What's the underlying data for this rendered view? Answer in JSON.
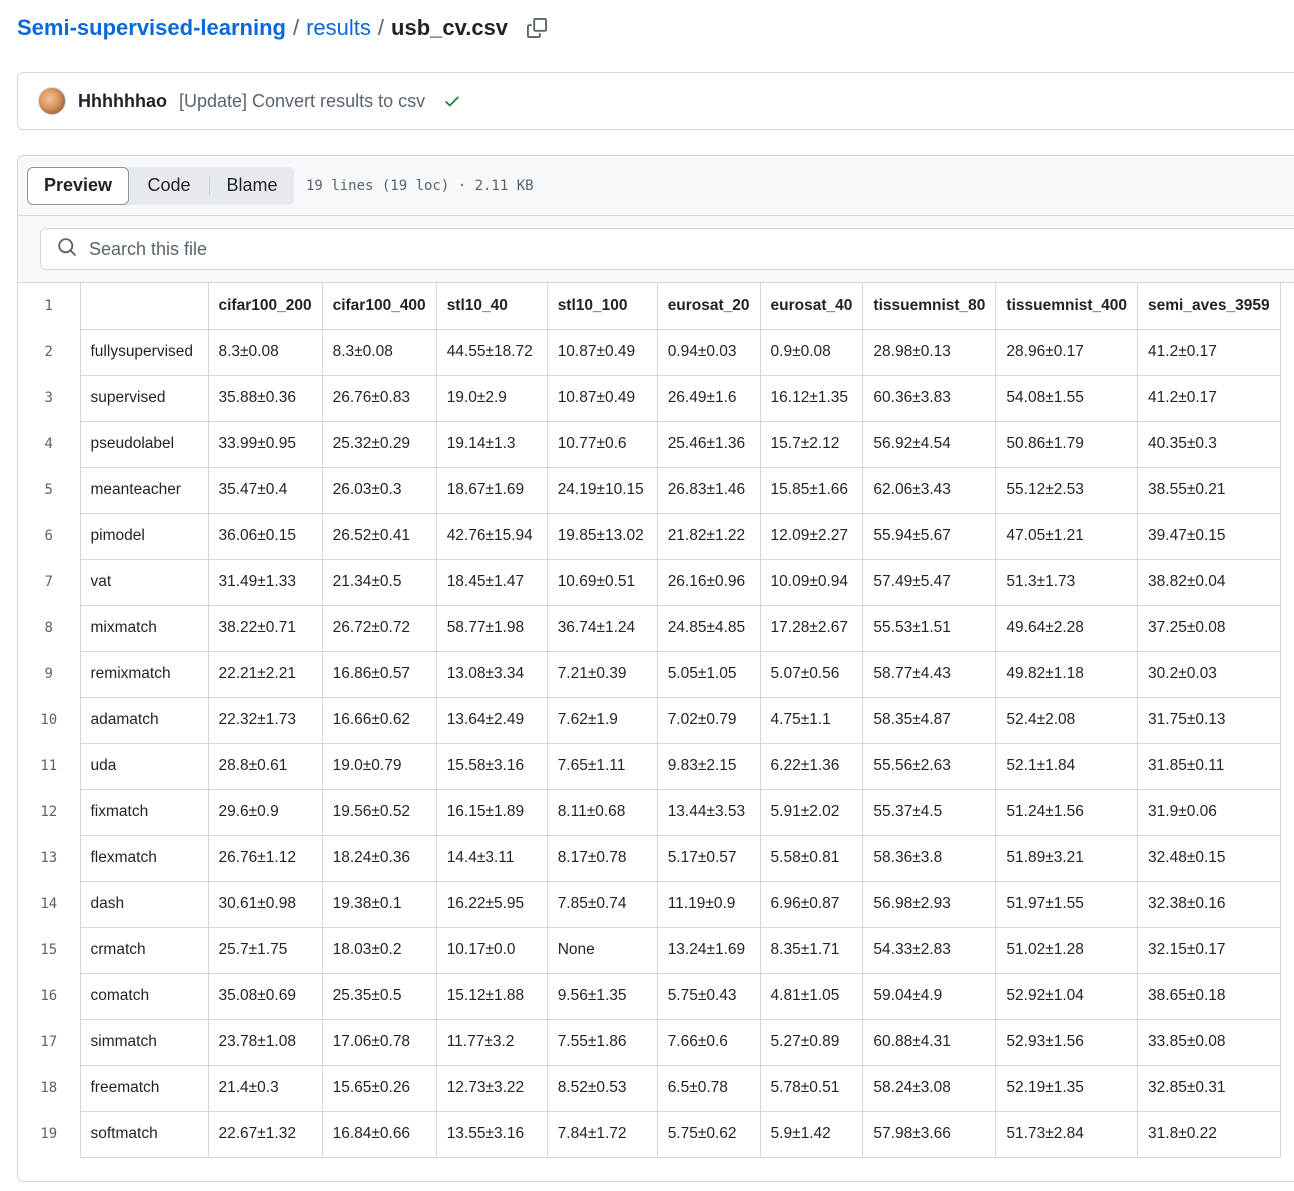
{
  "breadcrumb": {
    "repo": "Semi-supervised-learning",
    "sep1": "/",
    "folder": "results",
    "sep2": "/",
    "file": "usb_cv.csv"
  },
  "commit": {
    "author": "Hhhhhhao",
    "message": "[Update] Convert results to csv",
    "status_icon": "check-icon",
    "status_color": "#1a7f37"
  },
  "file_header": {
    "tabs": [
      "Preview",
      "Code",
      "Blame"
    ],
    "active_tab": "Preview",
    "meta": "19 lines (19 loc) · 2.11 KB"
  },
  "search": {
    "placeholder": "Search this file",
    "value": ""
  },
  "table": {
    "headers": [
      "",
      "cifar100_200",
      "cifar100_400",
      "stl10_40",
      "stl10_100",
      "eurosat_20",
      "eurosat_40",
      "tissuemnist_80",
      "tissuemnist_400",
      "semi_aves_3959"
    ],
    "rows": [
      [
        "fullysupervised",
        "8.3±0.08",
        "8.3±0.08",
        "44.55±18.72",
        "10.87±0.49",
        "0.94±0.03",
        "0.9±0.08",
        "28.98±0.13",
        "28.96±0.17",
        "41.2±0.17"
      ],
      [
        "supervised",
        "35.88±0.36",
        "26.76±0.83",
        "19.0±2.9",
        "10.87±0.49",
        "26.49±1.6",
        "16.12±1.35",
        "60.36±3.83",
        "54.08±1.55",
        "41.2±0.17"
      ],
      [
        "pseudolabel",
        "33.99±0.95",
        "25.32±0.29",
        "19.14±1.3",
        "10.77±0.6",
        "25.46±1.36",
        "15.7±2.12",
        "56.92±4.54",
        "50.86±1.79",
        "40.35±0.3"
      ],
      [
        "meanteacher",
        "35.47±0.4",
        "26.03±0.3",
        "18.67±1.69",
        "24.19±10.15",
        "26.83±1.46",
        "15.85±1.66",
        "62.06±3.43",
        "55.12±2.53",
        "38.55±0.21"
      ],
      [
        "pimodel",
        "36.06±0.15",
        "26.52±0.41",
        "42.76±15.94",
        "19.85±13.02",
        "21.82±1.22",
        "12.09±2.27",
        "55.94±5.67",
        "47.05±1.21",
        "39.47±0.15"
      ],
      [
        "vat",
        "31.49±1.33",
        "21.34±0.5",
        "18.45±1.47",
        "10.69±0.51",
        "26.16±0.96",
        "10.09±0.94",
        "57.49±5.47",
        "51.3±1.73",
        "38.82±0.04"
      ],
      [
        "mixmatch",
        "38.22±0.71",
        "26.72±0.72",
        "58.77±1.98",
        "36.74±1.24",
        "24.85±4.85",
        "17.28±2.67",
        "55.53±1.51",
        "49.64±2.28",
        "37.25±0.08"
      ],
      [
        "remixmatch",
        "22.21±2.21",
        "16.86±0.57",
        "13.08±3.34",
        "7.21±0.39",
        "5.05±1.05",
        "5.07±0.56",
        "58.77±4.43",
        "49.82±1.18",
        "30.2±0.03"
      ],
      [
        "adamatch",
        "22.32±1.73",
        "16.66±0.62",
        "13.64±2.49",
        "7.62±1.9",
        "7.02±0.79",
        "4.75±1.1",
        "58.35±4.87",
        "52.4±2.08",
        "31.75±0.13"
      ],
      [
        "uda",
        "28.8±0.61",
        "19.0±0.79",
        "15.58±3.16",
        "7.65±1.11",
        "9.83±2.15",
        "6.22±1.36",
        "55.56±2.63",
        "52.1±1.84",
        "31.85±0.11"
      ],
      [
        "fixmatch",
        "29.6±0.9",
        "19.56±0.52",
        "16.15±1.89",
        "8.11±0.68",
        "13.44±3.53",
        "5.91±2.02",
        "55.37±4.5",
        "51.24±1.56",
        "31.9±0.06"
      ],
      [
        "flexmatch",
        "26.76±1.12",
        "18.24±0.36",
        "14.4±3.11",
        "8.17±0.78",
        "5.17±0.57",
        "5.58±0.81",
        "58.36±3.8",
        "51.89±3.21",
        "32.48±0.15"
      ],
      [
        "dash",
        "30.61±0.98",
        "19.38±0.1",
        "16.22±5.95",
        "7.85±0.74",
        "11.19±0.9",
        "6.96±0.87",
        "56.98±2.93",
        "51.97±1.55",
        "32.38±0.16"
      ],
      [
        "crmatch",
        "25.7±1.75",
        "18.03±0.2",
        "10.17±0.0",
        "None",
        "13.24±1.69",
        "8.35±1.71",
        "54.33±2.83",
        "51.02±1.28",
        "32.15±0.17"
      ],
      [
        "comatch",
        "35.08±0.69",
        "25.35±0.5",
        "15.12±1.88",
        "9.56±1.35",
        "5.75±0.43",
        "4.81±1.05",
        "59.04±4.9",
        "52.92±1.04",
        "38.65±0.18"
      ],
      [
        "simmatch",
        "23.78±1.08",
        "17.06±0.78",
        "11.77±3.2",
        "7.55±1.86",
        "7.66±0.6",
        "5.27±0.89",
        "60.88±4.31",
        "52.93±1.56",
        "33.85±0.08"
      ],
      [
        "freematch",
        "21.4±0.3",
        "15.65±0.26",
        "12.73±3.22",
        "8.52±0.53",
        "6.5±0.78",
        "5.78±0.51",
        "58.24±3.08",
        "52.19±1.35",
        "32.85±0.31"
      ],
      [
        "softmatch",
        "22.67±1.32",
        "16.84±0.66",
        "13.55±3.16",
        "7.84±1.72",
        "5.75±0.62",
        "5.9±1.42",
        "57.98±3.66",
        "51.73±2.84",
        "31.8±0.22"
      ]
    ]
  },
  "colors": {
    "link": "#0969da",
    "text": "#1f2328",
    "muted": "#59636e",
    "border": "#d1d9e0",
    "header_bg": "#f6f8fa"
  }
}
